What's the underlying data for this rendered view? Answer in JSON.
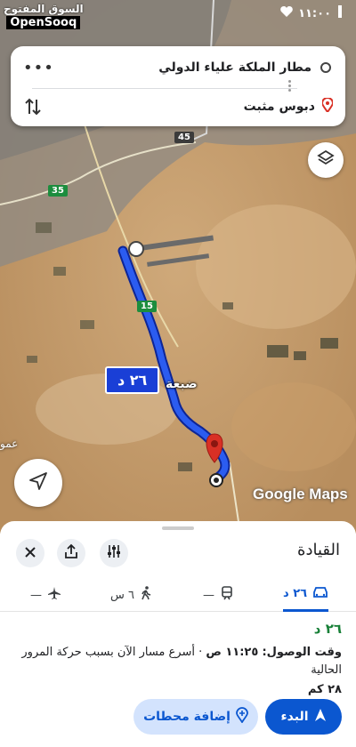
{
  "status_bar": {
    "time": "١١:٠٠"
  },
  "watermark": {
    "arabic": "السوق المفتوح",
    "brand": "OpenSooq"
  },
  "directions": {
    "origin": "مطار الملكة علياء الدولي",
    "destination": "دبوس مثبت"
  },
  "map": {
    "route_time_label": "٢٦ د",
    "town_label": "ضبعة",
    "edge_label": "عمو",
    "road_45": "45",
    "road_35": "35",
    "road_15": "15",
    "logo": "Google Maps",
    "route_color": "#1a3fd6"
  },
  "sheet": {
    "title": "القيادة",
    "modes": {
      "drive": "٢٦ د",
      "transit": "—",
      "walk": "٦ س",
      "flight": "—"
    },
    "result": {
      "duration": "٢٦ د",
      "arrival_label": "وقت الوصول:",
      "arrival_time": "١١:٢٥ ص",
      "arrival_note": " · أسرع مسار الآن بسبب حركة المرور الحالية",
      "distance": "٢٨ كم"
    },
    "start_label": "البدء",
    "add_stops_label": "إضافة محطات",
    "accent": "#0b57d0"
  }
}
